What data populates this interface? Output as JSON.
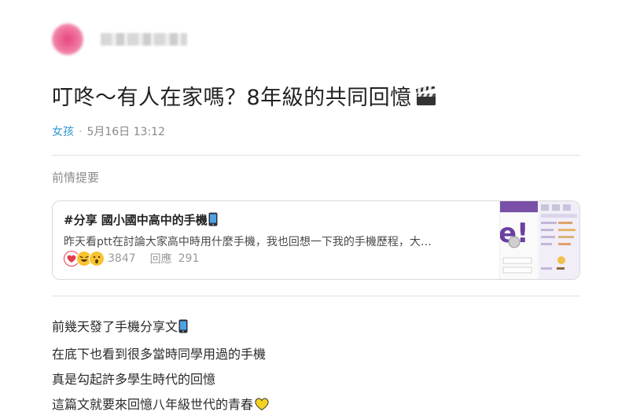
{
  "post": {
    "title": "叮咚～有人在家嗎？8年級的共同回憶",
    "title_icon": "clapperboard-icon",
    "board": "女孩",
    "separator": "·",
    "date": "5月16日 13:12"
  },
  "prior": {
    "section_label": "前情提要",
    "card": {
      "title": "#分享 國小國中高中的手機",
      "title_icon": "mobile-phone-icon",
      "excerpt": "昨天看ptt在討論大家高中時用什麼手機，我也回想一下我的手機歷程，大…",
      "reaction_icons": [
        "heart-reaction-icon",
        "laugh-reaction-icon",
        "wow-reaction-icon"
      ],
      "reaction_count": "3847",
      "reply_label": "回應",
      "reply_count": "291"
    }
  },
  "body": {
    "lines": [
      "前幾天發了手機分享文",
      "在底下也看到很多當時同學用過的手機",
      "真是勾起許多學生時代的回憶",
      "這篇文就要來回憶八年級世代的青春"
    ],
    "line_icons": [
      "mobile-phone-icon",
      "",
      "",
      "yellow-heart-icon"
    ]
  },
  "colors": {
    "board_link": "#3397cf",
    "heart": "#e53b4b",
    "yellow_heart": "#f5d21f"
  }
}
